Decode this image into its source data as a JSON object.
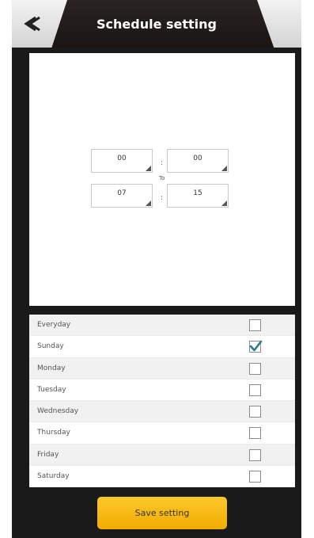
{
  "header": {
    "title": "Schedule setting",
    "back_icon": "chevron-double-left-icon"
  },
  "time_range": {
    "from": {
      "hour": "00",
      "minute": "00"
    },
    "to_label": "To",
    "to": {
      "hour": "07",
      "minute": "15"
    },
    "separator": ":"
  },
  "days": [
    {
      "label": "Everyday",
      "checked": false
    },
    {
      "label": "Sunday",
      "checked": true
    },
    {
      "label": "Monday",
      "checked": false
    },
    {
      "label": "Tuesday",
      "checked": false
    },
    {
      "label": "Wednesday",
      "checked": false
    },
    {
      "label": "Thursday",
      "checked": false
    },
    {
      "label": "Friday",
      "checked": false
    },
    {
      "label": "Saturday",
      "checked": false
    }
  ],
  "save_label": "Save setting",
  "colors": {
    "accent": "#f7b500",
    "check": "#2a7a8a",
    "header_bg": "#1e1a18"
  }
}
